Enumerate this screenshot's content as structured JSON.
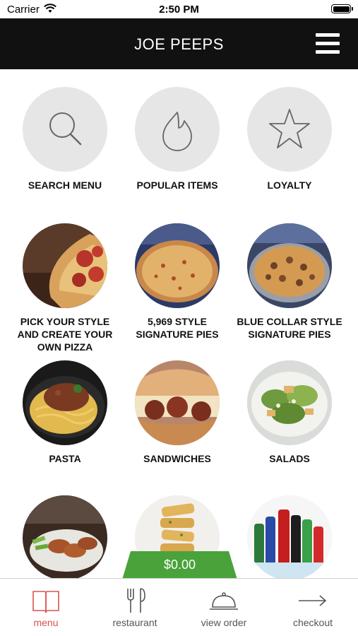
{
  "status_bar": {
    "carrier": "Carrier",
    "time": "2:50 PM"
  },
  "header": {
    "title": "JOE PEEPS",
    "menu_icon": "hamburger-icon"
  },
  "top_actions": [
    {
      "label": "SEARCH MENU",
      "icon": "search-icon"
    },
    {
      "label": "POPULAR ITEMS",
      "icon": "flame-icon"
    },
    {
      "label": "LOYALTY",
      "icon": "star-icon"
    }
  ],
  "categories": [
    {
      "label": "PICK YOUR STYLE AND CREATE YOUR OWN PIZZA",
      "image": "pizza-slice-image"
    },
    {
      "label": "5,969 STYLE SIGNATURE PIES",
      "image": "signature-pizza-image"
    },
    {
      "label": "BLUE COLLAR STYLE SIGNATURE PIES",
      "image": "blue-collar-pizza-image"
    },
    {
      "label": "PASTA",
      "image": "pasta-image"
    },
    {
      "label": "SANDWICHES",
      "image": "sandwich-image"
    },
    {
      "label": "SALADS",
      "image": "salad-image"
    },
    {
      "label": "",
      "image": "wings-image"
    },
    {
      "label": "",
      "image": "breadsticks-image"
    },
    {
      "label": "",
      "image": "drinks-image"
    }
  ],
  "order_total": "$0.00",
  "tab_bar": {
    "items": [
      {
        "label": "menu",
        "icon": "book-icon",
        "active": true
      },
      {
        "label": "restaurant",
        "icon": "fork-knife-icon",
        "active": false
      },
      {
        "label": "view order",
        "icon": "cloche-icon",
        "active": false
      },
      {
        "label": "checkout",
        "icon": "arrow-right-icon",
        "active": false
      }
    ]
  },
  "colors": {
    "header_bg": "#111111",
    "accent_green": "#4aa23a",
    "active_tab": "#d9534f",
    "circle_bg": "#e6e6e6"
  }
}
